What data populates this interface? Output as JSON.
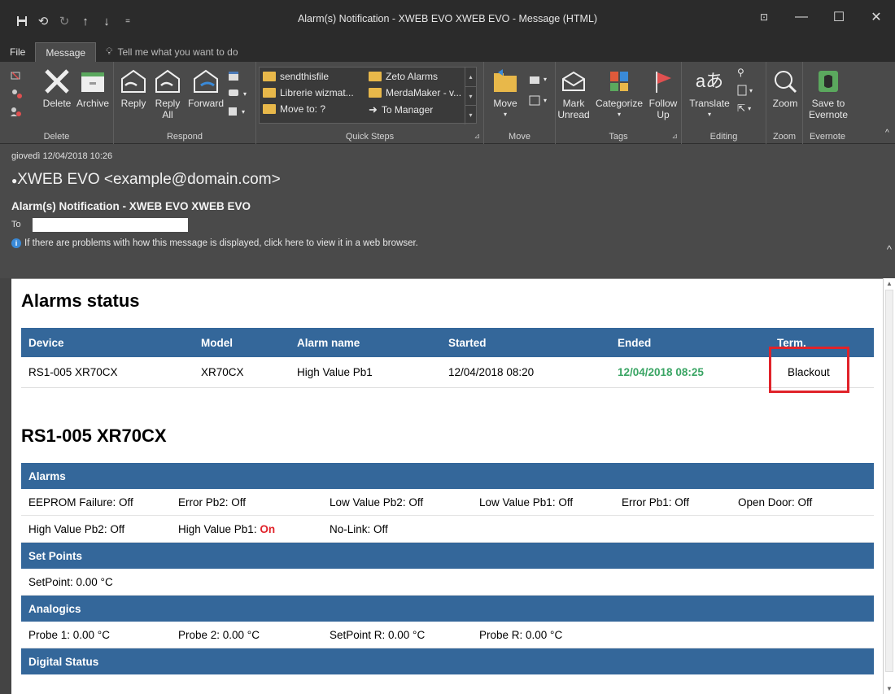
{
  "window": {
    "title": "Alarm(s) Notification - XWEB EVO XWEB EVO  -  Message (HTML)"
  },
  "tabs": [
    {
      "label": "File"
    },
    {
      "label": "Message"
    }
  ],
  "tell_me": "Tell me what you want to do",
  "ribbon": {
    "delete_group": {
      "label": "Delete",
      "delete": "Delete",
      "archive": "Archive"
    },
    "respond_group": {
      "label": "Respond",
      "reply": "Reply",
      "reply_all_1": "Reply",
      "reply_all_2": "All",
      "forward": "Forward"
    },
    "quick_steps": {
      "label": "Quick Steps",
      "items": [
        "sendthisfile",
        "Zeto Alarms",
        "Librerie wizmat...",
        "MerdaMaker - v...",
        "Move to: ?",
        "To Manager"
      ]
    },
    "move_group": {
      "label": "Move",
      "move": "Move"
    },
    "tags_group": {
      "label": "Tags",
      "mark_1": "Mark",
      "mark_2": "Unread",
      "categorize": "Categorize",
      "follow_1": "Follow",
      "follow_2": "Up"
    },
    "editing_group": {
      "label": "Editing",
      "translate": "Translate"
    },
    "zoom_group": {
      "label": "Zoom",
      "zoom": "Zoom"
    },
    "evernote_group": {
      "label": "Evernote",
      "save_1": "Save to",
      "save_2": "Evernote"
    }
  },
  "header": {
    "date": "giovedì 12/04/2018 10:26",
    "sender": "XWEB EVO <example@domain.com>",
    "subject": "Alarm(s) Notification - XWEB EVO XWEB EVO",
    "to_label": "To",
    "info": "If there are problems with how this message is displayed, click here to view it in a web browser."
  },
  "message": {
    "status_title": "Alarms status",
    "status_columns": [
      "Device",
      "Model",
      "Alarm name",
      "Started",
      "Ended",
      "Term."
    ],
    "status_row": {
      "device": "RS1-005 XR70CX",
      "model": "XR70CX",
      "alarm": "High Value Pb1",
      "started": "12/04/2018 08:20",
      "ended": "12/04/2018 08:25",
      "term": "Blackout"
    },
    "device_title": "RS1-005 XR70CX",
    "sections": {
      "alarms": "Alarms",
      "set_points": "Set Points",
      "analogics": "Analogics",
      "digital": "Digital Status"
    },
    "alarms_row1": [
      "EEPROM Failure: Off",
      "Error Pb2: Off",
      "Low Value Pb2: Off",
      "Low Value Pb1: Off",
      "Error Pb1: Off",
      "Open Door: Off"
    ],
    "alarms_row2": {
      "a": "High Value Pb2: Off",
      "b_label": "High Value Pb1: ",
      "b_value": "On",
      "c": "No-Link: Off"
    },
    "set_point": "SetPoint: 0.00 °C",
    "analogics": [
      "Probe 1: 0.00 °C",
      "Probe 2: 0.00 °C",
      "SetPoint R: 0.00 °C",
      "Probe R: 0.00 °C"
    ]
  },
  "colors": {
    "table_header": "#34679a",
    "ended_green": "#3aa564",
    "alarm_red": "#e0232a",
    "highlight_box": "#e0232a"
  }
}
